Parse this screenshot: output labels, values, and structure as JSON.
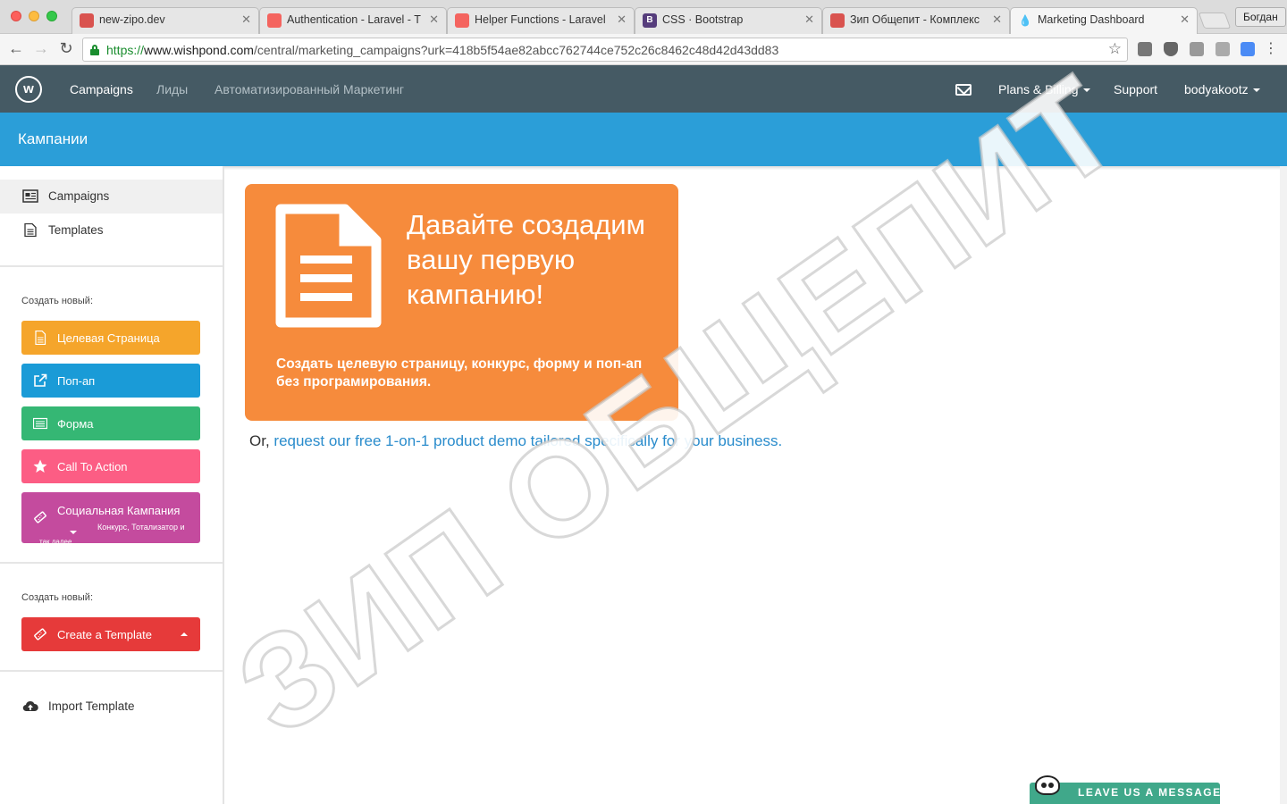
{
  "browser": {
    "tabs": [
      {
        "title": "new-zipo.dev",
        "favicon_color": "#d9534f",
        "favicon_glyph": ""
      },
      {
        "title": "Authentication - Laravel - T",
        "favicon_color": "#f4645f",
        "favicon_glyph": ""
      },
      {
        "title": "Helper Functions - Laravel",
        "favicon_color": "#f4645f",
        "favicon_glyph": ""
      },
      {
        "title": "CSS · Bootstrap",
        "favicon_color": "#563d7c",
        "favicon_glyph": "B"
      },
      {
        "title": "Зип Общепит - Комплекс",
        "favicon_color": "#d9534f",
        "favicon_glyph": ""
      },
      {
        "title": "Marketing Dashboard",
        "favicon_color": "#2b9ed8",
        "favicon_glyph": "💧"
      }
    ],
    "profile": "Богдан",
    "url_scheme": "https://",
    "url_host": "www.wishpond.com",
    "url_rest": "/central/marketing_campaigns?urk=418b5f54ae82abcc762744ce752c26c8462c48d42d43dd83"
  },
  "nav": {
    "logo": "w",
    "links": [
      "Campaigns",
      "Лиды",
      "Автоматизированный Маркетинг"
    ],
    "plans": "Plans & Billing",
    "support": "Support",
    "user": "bodyakootz"
  },
  "page": {
    "title": "Кампании"
  },
  "sidebar": {
    "items": [
      "Campaigns",
      "Templates"
    ],
    "create_label": "Создать новый:",
    "create_buttons": [
      {
        "label": "Целевая Страница",
        "color": "#f5a52b"
      },
      {
        "label": "Поп-ап",
        "color": "#1a9bd7"
      },
      {
        "label": "Форма",
        "color": "#35b774"
      },
      {
        "label": "Call To Action",
        "color": "#fc5d84"
      },
      {
        "label": "Социальная Кампания",
        "color": "#c44b9e",
        "sub": "Конкурс, Тотализатор и",
        "sub2": "так далее"
      }
    ],
    "create_label_2": "Создать новый:",
    "template_button": {
      "label": "Create a Template",
      "color": "#e63a3a"
    },
    "import": "Import Template"
  },
  "hero": {
    "heading": "Давайте создадим вашу первую кампанию!",
    "text": "Создать целевую страницу, конкурс, форму и поп-ап без програмирования.",
    "demo_prefix": "Or,",
    "demo_link": "request our free 1-on-1 product demo tailored specifically for your business."
  },
  "watermark": "ЗИП ОБЩЕПИТ",
  "chat": {
    "label": "LEAVE US A MESSAGE"
  },
  "colors": {
    "nav_bg": "#455a64",
    "header_bg": "#2b9ed8",
    "hero_bg": "#f68b3c",
    "chat_bg": "#40a88a"
  }
}
